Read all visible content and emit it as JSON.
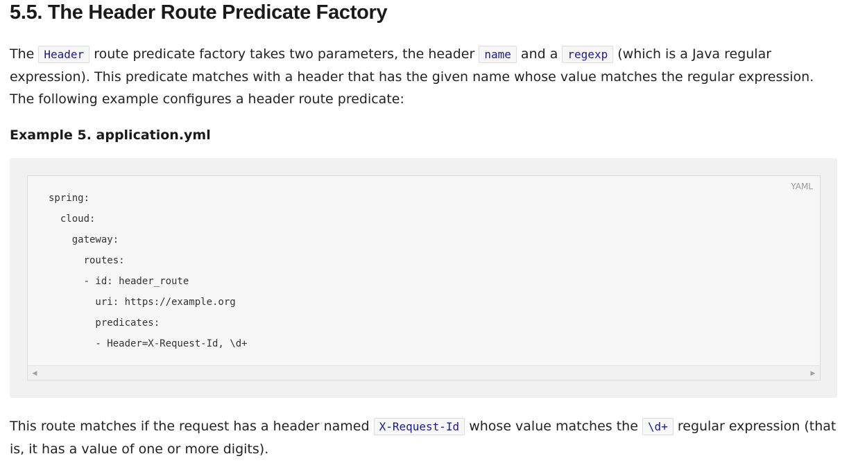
{
  "heading": "5.5. The Header Route Predicate Factory",
  "intro": {
    "t1": "The ",
    "c1": "Header",
    "t2": " route predicate factory takes two parameters, the header ",
    "c2": "name",
    "t3": " and a ",
    "c3": "regexp",
    "t4": " (which is a Java regular expression). This predicate matches with a header that has the given name whose value matches the regular expression. The following example configures a header route predicate:"
  },
  "example_caption": "Example 5. application.yml",
  "code_block": {
    "language": "YAML",
    "lines": [
      "spring:",
      "  cloud:",
      "    gateway:",
      "      routes:",
      "      - id: header_route",
      "        uri: https://example.org",
      "        predicates:",
      "        - Header=X-Request-Id, \\d+"
    ]
  },
  "outro": {
    "t1": "This route matches if the request has a header named ",
    "c1": "X-Request-Id",
    "t2": " whose value matches the ",
    "c2": "\\d+",
    "t3": " regular expression (that is, it has a value of one or more digits)."
  },
  "icons": {
    "scroll_left": "scroll-left-arrow-icon",
    "scroll_right": "scroll-right-arrow-icon"
  }
}
